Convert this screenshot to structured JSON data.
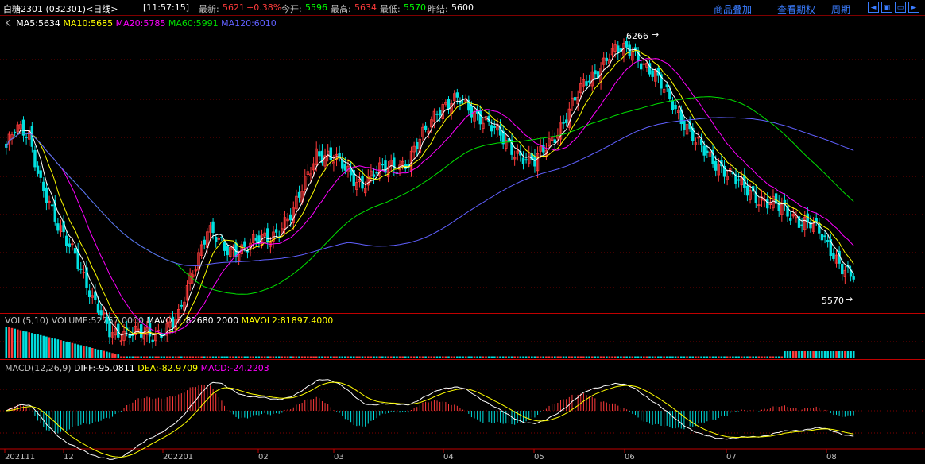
{
  "header": {
    "symbol": "白糖2301 (032301)<日线>",
    "time": "[11:57:15]",
    "latest_label": "最新:",
    "latest": "5621",
    "change": "+0.38%",
    "open_label": "今开:",
    "open": "5596",
    "high_label": "最高:",
    "high": "5634",
    "low_label": "最低:",
    "low": "5570",
    "prev_label": "昨结:",
    "prev": "5600",
    "links": [
      "商品叠加",
      "查看期权",
      "周期"
    ]
  },
  "ma_line": {
    "k": "K",
    "ma5": "MA5:5634",
    "ma10": "MA10:5685",
    "ma20": "MA20:5785",
    "ma60": "MA60:5991",
    "ma120": "MA120:6010"
  },
  "vol_line": {
    "vol": "VOL(5,10)",
    "volume": "VOLUME:52767.0000",
    "mavol1": "MAVOL1:82680.2000",
    "mavol2": "MAVOL2:81897.4000"
  },
  "macd_line": {
    "macd_title": "MACD(12,26,9)",
    "diff": "DIFF:-95.0811",
    "dea": "DEA:-82.9709",
    "macd": "MACD:-24.2203"
  },
  "annotations": {
    "high": "6266",
    "low": "5570"
  },
  "x_labels": [
    "202111",
    "12",
    "202201",
    "02",
    "03",
    "04",
    "05",
    "06",
    "07",
    "08"
  ],
  "colors": {
    "up": "#ff3b3b",
    "down": "#00e0e0",
    "ma5": "#ffffff",
    "ma10": "#ffff00",
    "ma20": "#ff00ff",
    "ma60": "#00e000",
    "ma120": "#6060ff",
    "link": "#3a7cff"
  },
  "chart_data": {
    "type": "candlestick",
    "close_keypoints": [
      [
        0,
        5950
      ],
      [
        3,
        6000
      ],
      [
        8,
        5990
      ],
      [
        12,
        5850
      ],
      [
        18,
        5700
      ],
      [
        24,
        5640
      ],
      [
        30,
        5480
      ],
      [
        36,
        5400
      ],
      [
        44,
        5380
      ],
      [
        52,
        5390
      ],
      [
        56,
        5400
      ],
      [
        60,
        5430
      ],
      [
        64,
        5560
      ],
      [
        70,
        5700
      ],
      [
        76,
        5640
      ],
      [
        84,
        5650
      ],
      [
        92,
        5680
      ],
      [
        100,
        5750
      ],
      [
        108,
        5940
      ],
      [
        116,
        5900
      ],
      [
        124,
        5840
      ],
      [
        134,
        5900
      ],
      [
        140,
        5900
      ],
      [
        150,
        6070
      ],
      [
        158,
        6090
      ],
      [
        166,
        6040
      ],
      [
        174,
        5960
      ],
      [
        184,
        5900
      ],
      [
        194,
        6030
      ],
      [
        202,
        6150
      ],
      [
        210,
        6230
      ],
      [
        218,
        6250
      ],
      [
        224,
        6180
      ],
      [
        232,
        6090
      ],
      [
        240,
        5960
      ],
      [
        248,
        5900
      ],
      [
        256,
        5830
      ],
      [
        264,
        5790
      ],
      [
        272,
        5750
      ],
      [
        280,
        5720
      ],
      [
        288,
        5630
      ],
      [
        294,
        5560
      ]
    ],
    "price_range": [
      5470,
      6300
    ],
    "high": 6266,
    "low": 5570
  }
}
